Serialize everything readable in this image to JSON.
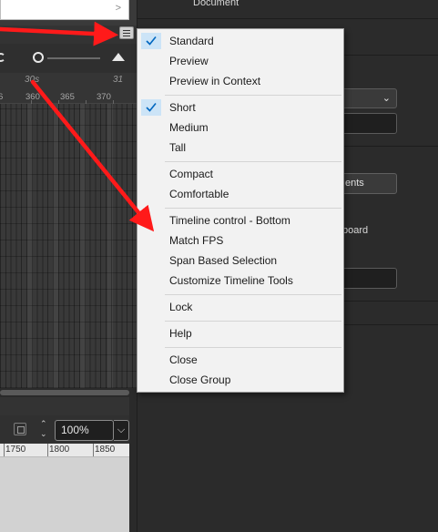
{
  "properties_panel": {
    "document_label": "Document",
    "button_fragment": "ents",
    "text_fragment": "board"
  },
  "timeline": {
    "seconds_label": "30s",
    "seconds_label_right": "31",
    "frame_labels": [
      "6",
      "360",
      "365",
      "370"
    ]
  },
  "stage_toolbar": {
    "zoom_value": "100%",
    "ruler_labels": [
      "1750",
      "1800",
      "1850"
    ]
  },
  "context_menu": {
    "items": [
      {
        "label": "Standard",
        "checked": true
      },
      {
        "label": "Preview",
        "checked": false
      },
      {
        "label": "Preview in Context",
        "checked": false
      },
      {
        "label": "Short",
        "checked": true
      },
      {
        "label": "Medium",
        "checked": false
      },
      {
        "label": "Tall",
        "checked": false
      },
      {
        "label": "Compact",
        "checked": false
      },
      {
        "label": "Comfortable",
        "checked": false
      },
      {
        "label": "Timeline control - Bottom",
        "checked": false
      },
      {
        "label": "Match FPS",
        "checked": false
      },
      {
        "label": "Span Based Selection",
        "checked": false
      },
      {
        "label": "Customize Timeline Tools",
        "checked": false
      },
      {
        "label": "Lock",
        "checked": false
      },
      {
        "label": "Help",
        "checked": false
      },
      {
        "label": "Close",
        "checked": false
      },
      {
        "label": "Close Group",
        "checked": false
      }
    ]
  },
  "colors": {
    "annotation_arrow": "#ff1a1a",
    "check_highlight": "#cce4f7",
    "menu_background": "#f2f2f2"
  },
  "icons": {
    "panel_menu": "hamburger-menu-icon",
    "checkmark": "checkmark-icon",
    "fit_stage": "fit-stage-icon",
    "zoom_dropdown": "chevron-down-icon"
  }
}
